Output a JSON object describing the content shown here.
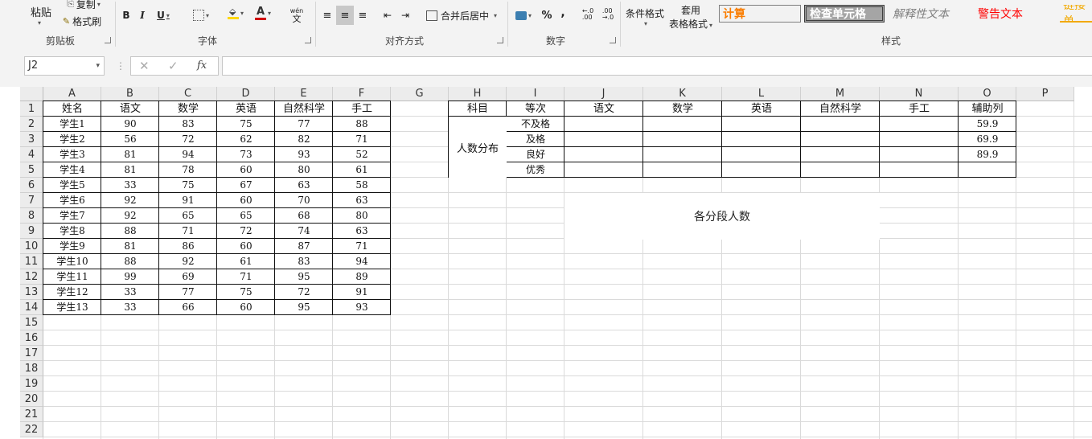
{
  "ribbon": {
    "clipboard": {
      "paste": "粘贴",
      "copy": "复制",
      "format_painter": "格式刷",
      "label": "剪贴板"
    },
    "font": {
      "bold": "B",
      "italic": "I",
      "underline": "U",
      "font_color": "A",
      "phonetic": "wén",
      "phonetic_char": "文",
      "label": "字体"
    },
    "alignment": {
      "merge_center": "合并后居中",
      "label": "对齐方式"
    },
    "number": {
      "percent": "%",
      "comma": ",",
      "label": "数字"
    },
    "styles": {
      "conditional_format": "条件格式",
      "table_format_1": "套用",
      "table_format_2": "表格格式",
      "cell_styles": [
        "计算",
        "检查单元格",
        "解释性文本",
        "警告文本",
        "链接单"
      ],
      "label": "样式"
    }
  },
  "formula_bar": {
    "name_box": "J2",
    "formula": ""
  },
  "columns": [
    "A",
    "B",
    "C",
    "D",
    "E",
    "F",
    "G",
    "H",
    "I",
    "J",
    "K",
    "L",
    "M",
    "N",
    "O",
    "P"
  ],
  "rows": [
    1,
    2,
    3,
    4,
    5,
    6,
    7,
    8,
    9,
    10,
    11,
    12,
    13,
    14,
    15,
    16,
    17,
    18,
    19,
    20,
    21,
    22
  ],
  "scores": {
    "headers": [
      "姓名",
      "语文",
      "数学",
      "英语",
      "自然科学",
      "手工"
    ],
    "data": [
      [
        "学生1",
        "90",
        "83",
        "75",
        "77",
        "88"
      ],
      [
        "学生2",
        "56",
        "72",
        "62",
        "82",
        "71"
      ],
      [
        "学生3",
        "81",
        "94",
        "73",
        "93",
        "52"
      ],
      [
        "学生4",
        "81",
        "78",
        "60",
        "80",
        "61"
      ],
      [
        "学生5",
        "33",
        "75",
        "67",
        "63",
        "58"
      ],
      [
        "学生6",
        "92",
        "91",
        "60",
        "70",
        "63"
      ],
      [
        "学生7",
        "92",
        "65",
        "65",
        "68",
        "80"
      ],
      [
        "学生8",
        "88",
        "71",
        "72",
        "74",
        "63"
      ],
      [
        "学生9",
        "81",
        "86",
        "60",
        "87",
        "71"
      ],
      [
        "学生10",
        "88",
        "92",
        "61",
        "83",
        "94"
      ],
      [
        "学生11",
        "99",
        "69",
        "71",
        "95",
        "89"
      ],
      [
        "学生12",
        "33",
        "77",
        "75",
        "72",
        "91"
      ],
      [
        "学生13",
        "33",
        "66",
        "60",
        "95",
        "93"
      ]
    ]
  },
  "distribution": {
    "headers": [
      "科目",
      "等次",
      "语文",
      "数学",
      "英语",
      "自然科学",
      "手工",
      "辅助列"
    ],
    "merged_label": "人数分布",
    "grades": [
      "不及格",
      "及格",
      "良好",
      "优秀"
    ],
    "helper": [
      "59.9",
      "69.9",
      "89.9",
      ""
    ]
  },
  "chart_title": "各分段人数",
  "colors": {
    "calc_style_text": "#fa7d00",
    "check_cell_bg": "#a5a5a5",
    "warning_text": "#ff0000",
    "link_text": "#f2a900",
    "font_color_red": "#d00000",
    "highlight_yellow": "#ffd700"
  }
}
